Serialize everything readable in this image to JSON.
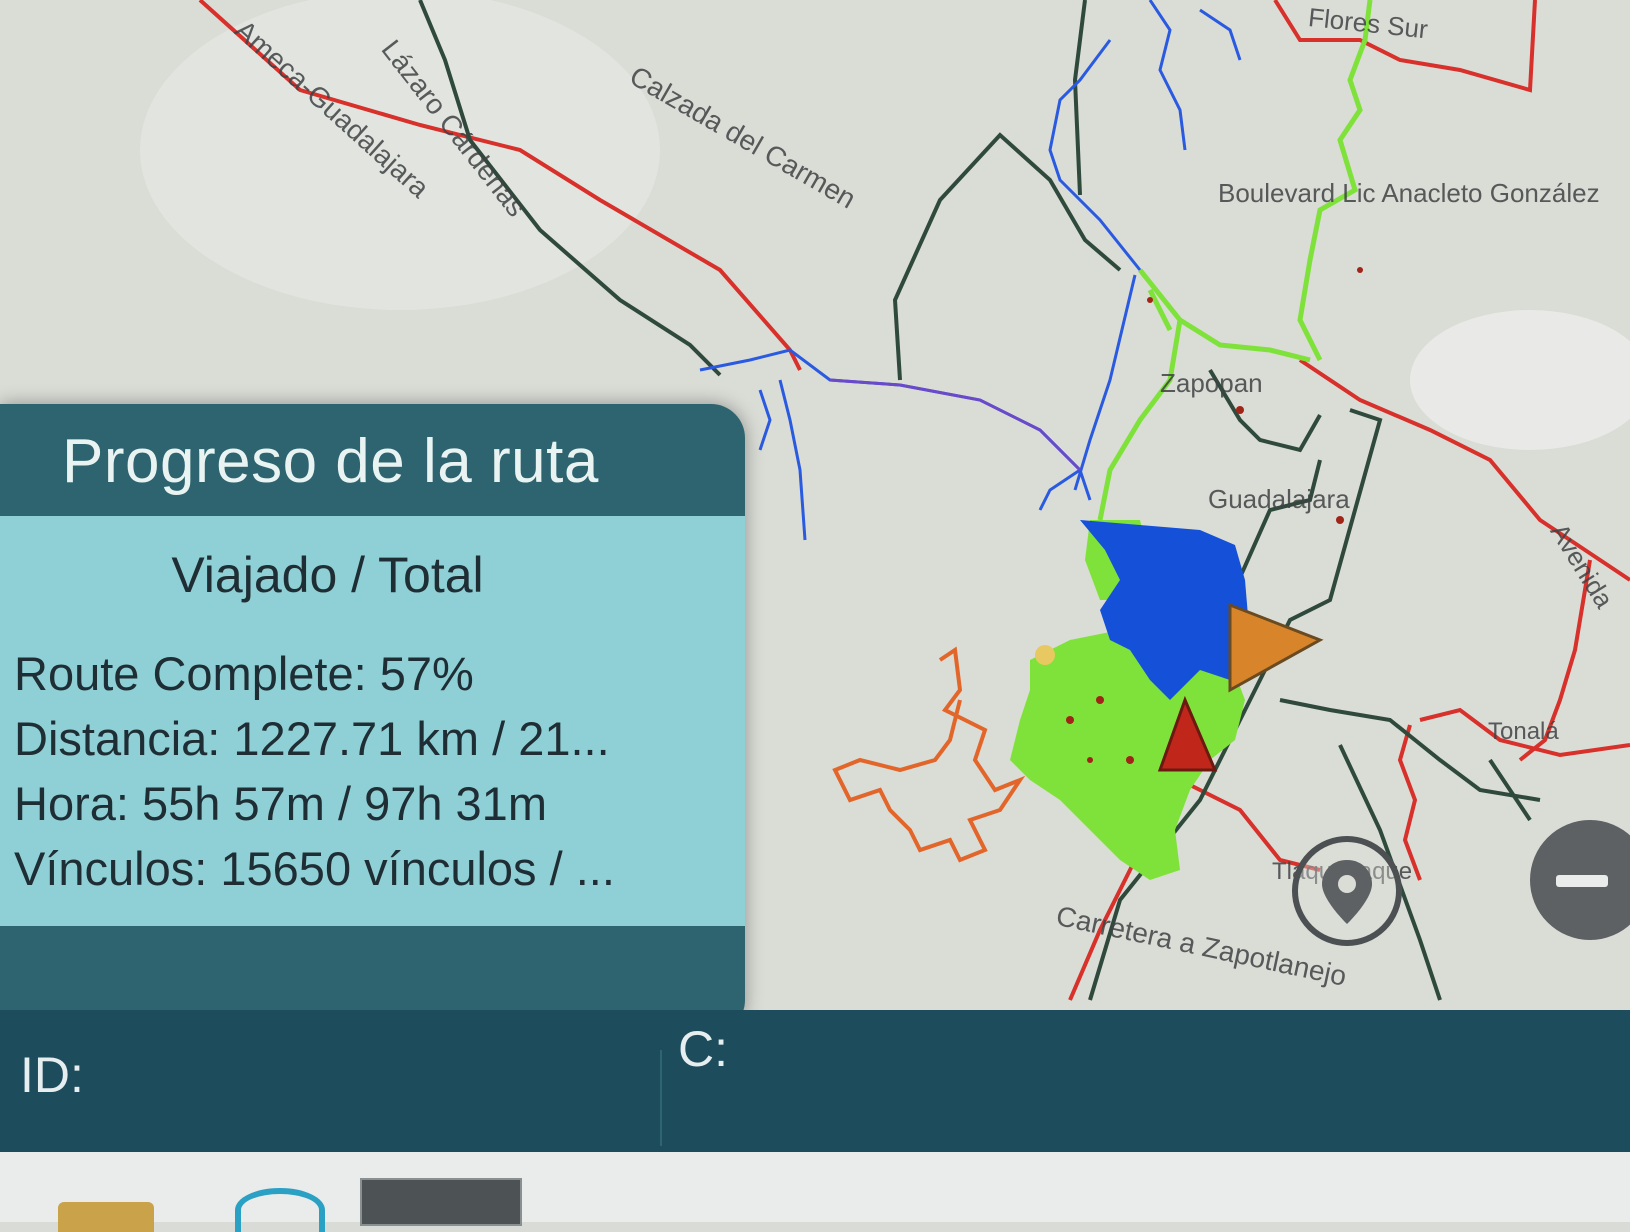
{
  "panel": {
    "title": "Progreso de la ruta",
    "subtitle": "Viajado / Total",
    "route_complete": "Route Complete: 57%",
    "distance": "Distancia: 1227.71 km / 21...",
    "time": "Hora: 55h 57m / 97h 31m",
    "links": "Vínculos: 15650 vínculos / ..."
  },
  "status_bar": {
    "id_label": "ID:",
    "c_label": "C:"
  },
  "map_labels": {
    "ameca": "Ameca-Guadalajara",
    "lazaro": "Lázaro Cárdenas",
    "calzada": "Calzada del Carmen",
    "flores": "Flores Sur",
    "boulevard": "Boulevard Lic Anacleto González",
    "zapopan": "Zapopan",
    "guadalajara": "Guadalajara",
    "avenida": "Avenida",
    "tonala": "Tonalá",
    "tlaquepaque": "Tlaquepaque",
    "carretera": "Carretera a Zapotlanejo"
  },
  "colors": {
    "traveled": "#1450d8",
    "remaining": "#7ee23a",
    "alt_route": "#e2662a",
    "highway": "#d8302a",
    "road": "#2f4a3c",
    "vehicle_orange": "#d8842a",
    "vehicle_red": "#c0261a"
  },
  "icons": [
    "vehicle-arrow-icon",
    "destination-marker-icon",
    "locate-pin-icon",
    "zoom-out-icon",
    "folder-icon",
    "browser-icon"
  ]
}
